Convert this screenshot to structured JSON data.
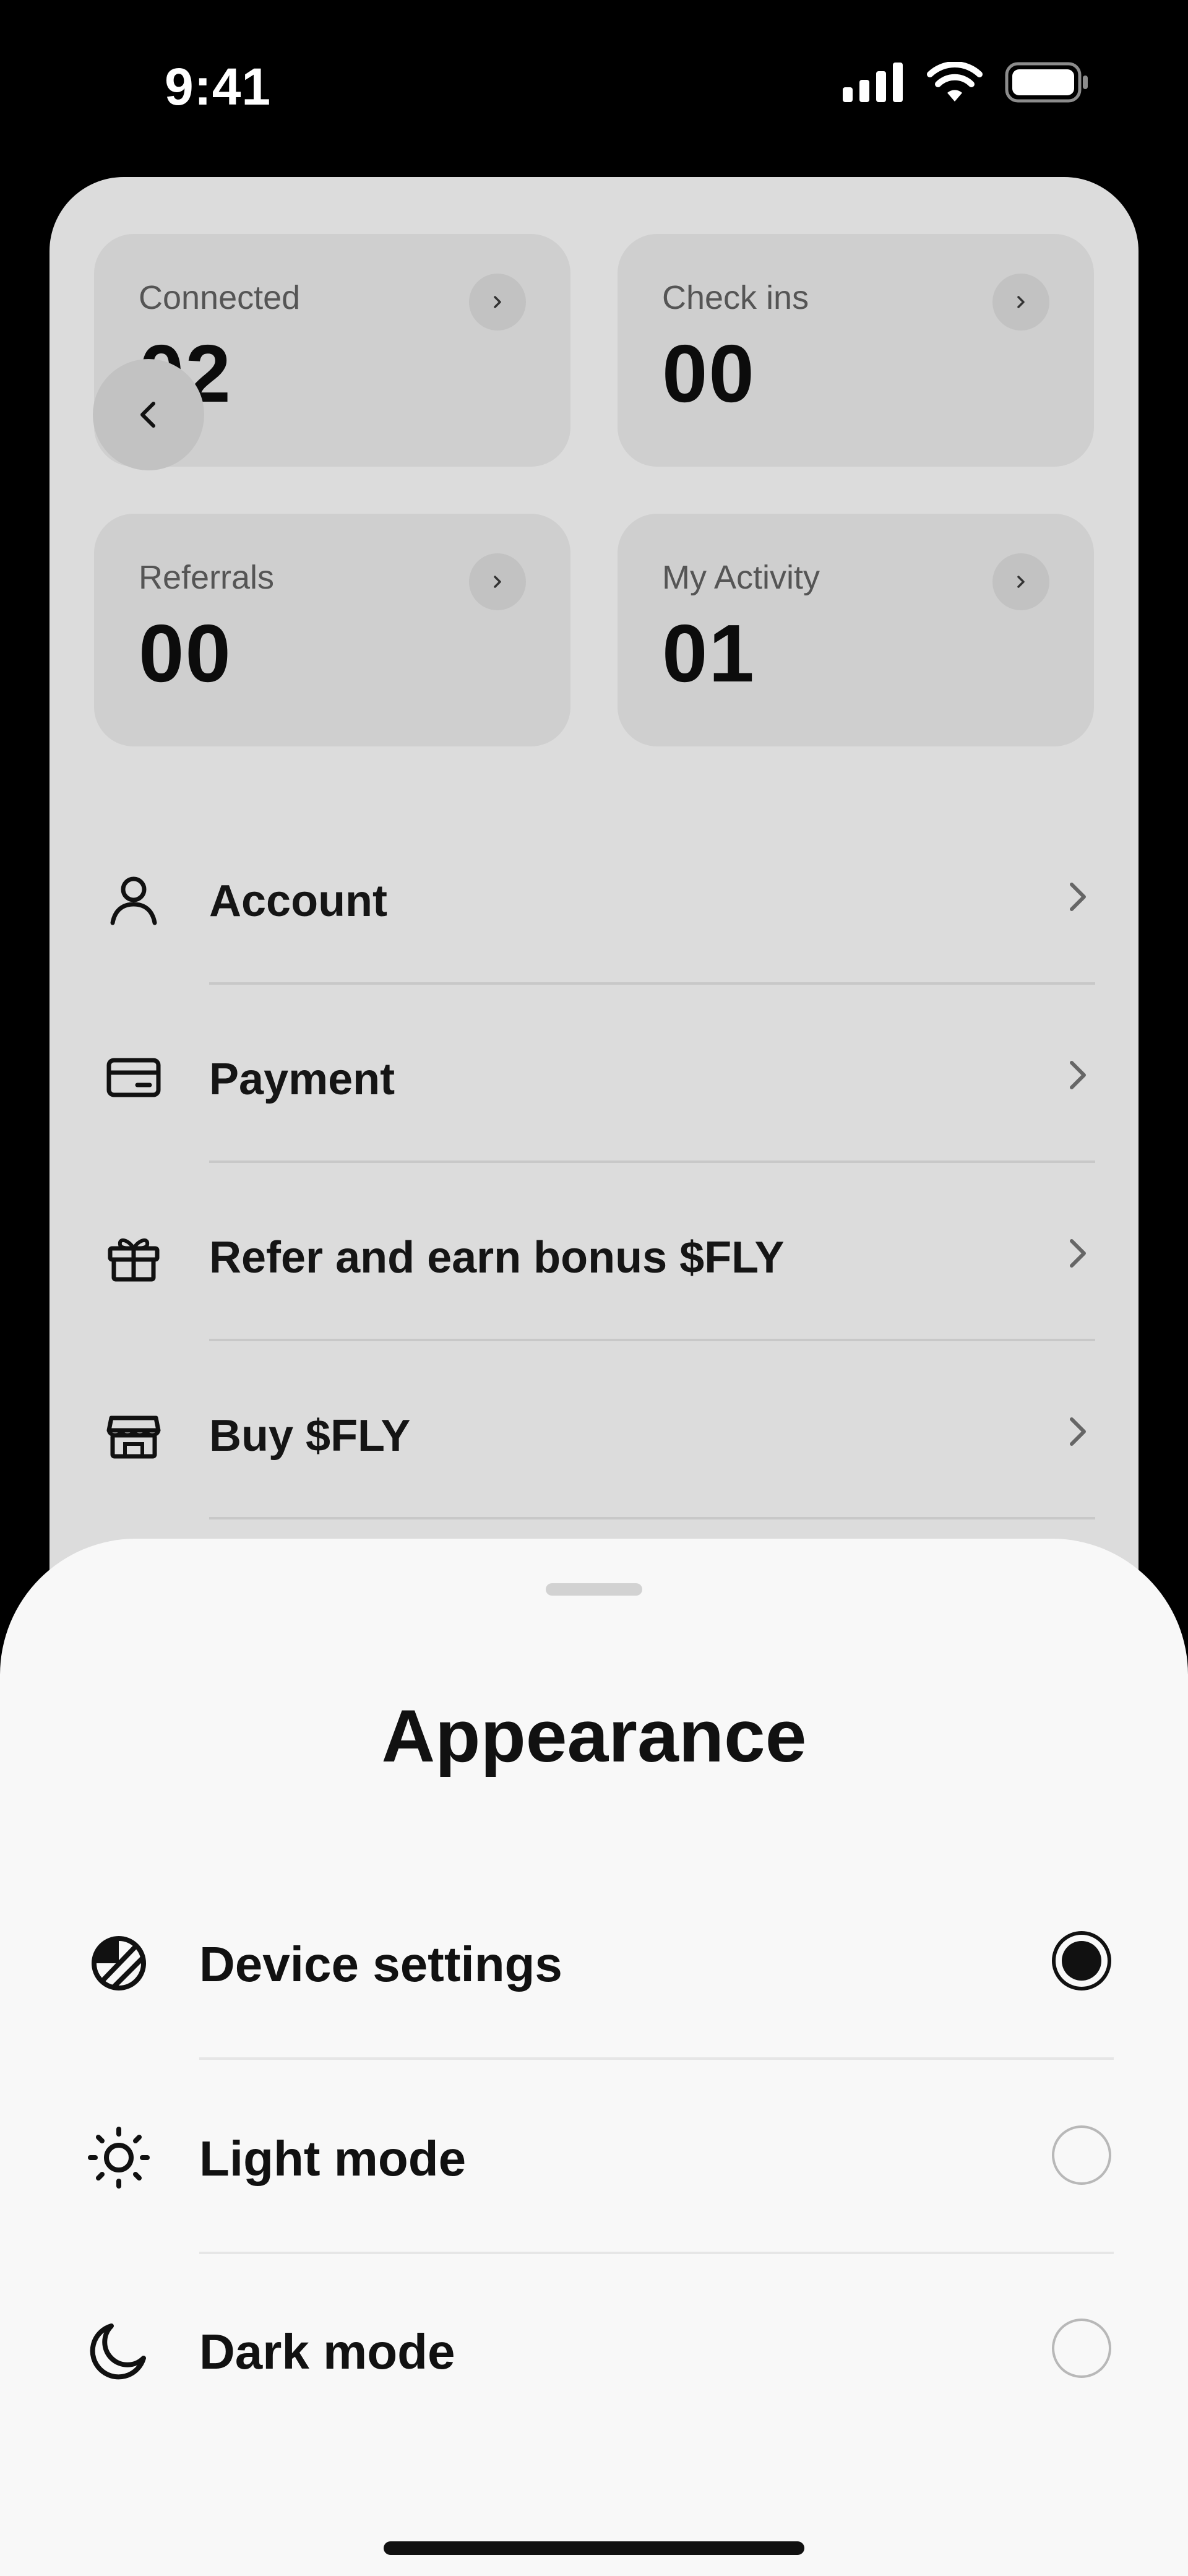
{
  "status_bar": {
    "time": "9:41",
    "icons": [
      "cellular-signal-icon",
      "wifi-icon",
      "battery-icon"
    ]
  },
  "stats": [
    {
      "label": "Connected",
      "value": "02"
    },
    {
      "label": "Check ins",
      "value": "00"
    },
    {
      "label": "Referrals",
      "value": "00"
    },
    {
      "label": "My Activity",
      "value": "01"
    }
  ],
  "menu": {
    "items": [
      {
        "label": "Account",
        "icon": "user-icon"
      },
      {
        "label": "Payment",
        "icon": "credit-card-icon"
      },
      {
        "label": "Refer and earn bonus $FLY",
        "icon": "gift-icon"
      },
      {
        "label": "Buy $FLY",
        "icon": "store-icon"
      }
    ]
  },
  "sheet": {
    "title": "Appearance",
    "options": [
      {
        "label": "Device settings",
        "icon": "device-settings-icon",
        "selected": true
      },
      {
        "label": "Light mode",
        "icon": "sun-icon",
        "selected": false
      },
      {
        "label": "Dark mode",
        "icon": "moon-icon",
        "selected": false
      }
    ]
  },
  "colors": {
    "background": "#000000",
    "card": "#dcdcdc",
    "tile": "#cfcfcf",
    "sheet": "#f8f8f8",
    "text": "#111111"
  }
}
